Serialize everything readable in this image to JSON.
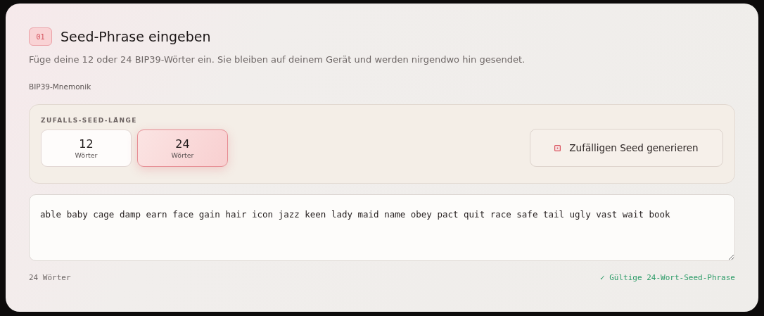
{
  "step": {
    "number": "01",
    "title": "Seed-Phrase eingeben",
    "description": "Füge deine 12 oder 24 BIP39-Wörter ein. Sie bleiben auf deinem Gerät und werden nirgendwo hin gesendet."
  },
  "field_label": "BIP39-Mnemonik",
  "length_panel": {
    "heading": "ZUFALLS-SEED-LÄNGE",
    "options": [
      {
        "count": "12",
        "unit": "Wörter",
        "selected": false
      },
      {
        "count": "24",
        "unit": "Wörter",
        "selected": true
      }
    ],
    "generate_button": "Zufälligen Seed generieren"
  },
  "mnemonic": {
    "value": "able baby cage damp earn face gain hair icon jazz keen lady maid name obey pact quit race safe tail ugly vast wait book"
  },
  "footer": {
    "word_count": "24 Wörter",
    "validation": "✓ Gültige 24-Wort-Seed-Phrase"
  }
}
